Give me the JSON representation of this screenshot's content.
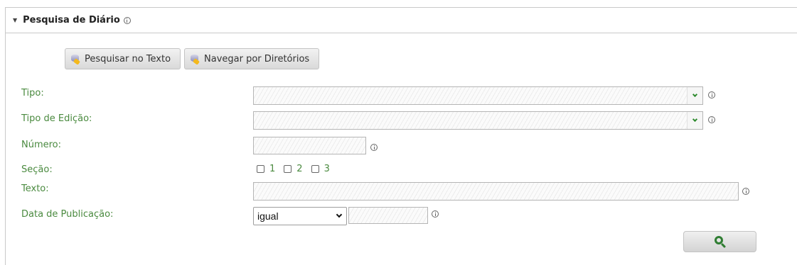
{
  "panel": {
    "title": "Pesquisa de Diário"
  },
  "toolbar": {
    "search_text_label": "Pesquisar no Texto",
    "browse_dirs_label": "Navegar por Diretórios"
  },
  "form": {
    "tipo_label": "Tipo:",
    "tipo_edicao_label": "Tipo de Edição:",
    "numero_label": "Número:",
    "secao_label": "Seção:",
    "secao_options": [
      "1",
      "2",
      "3"
    ],
    "texto_label": "Texto:",
    "data_publicacao_label": "Data de Publicação:",
    "data_operator_value": "igual"
  },
  "icons": {
    "collapse": "triangle-down-icon",
    "info": "info-icon",
    "dropdown": "chevron-down-icon",
    "search": "magnifier-icon",
    "toolbar_button": "database-search-icon"
  },
  "colors": {
    "label_green": "#4a8a3f",
    "accent_green": "#2e8b2e"
  }
}
